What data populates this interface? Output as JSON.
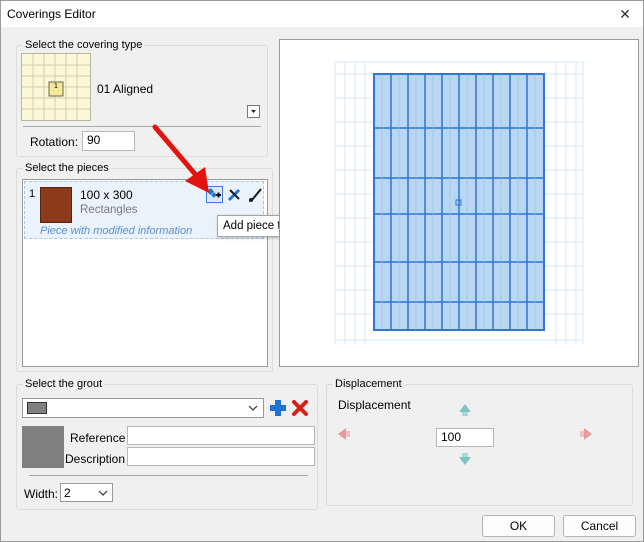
{
  "window": {
    "title": "Coverings Editor",
    "close_glyph": "✕"
  },
  "covering": {
    "section_label": "Select the covering type",
    "thumb_label": "1",
    "type_name": "01 Aligned",
    "rotation_label": "Rotation:",
    "rotation_value": "90"
  },
  "pieces": {
    "section_label": "Select the pieces",
    "items": [
      {
        "index": "1",
        "size": "100 x 300",
        "shape": "Rectangles",
        "note": "Piece with modified information"
      }
    ],
    "tooltip": "Add piece to library"
  },
  "grout": {
    "section_label": "Select the grout",
    "reference_label": "Reference",
    "reference_value": "",
    "description_label": "Description",
    "description_value": "",
    "width_label": "Width:",
    "width_value": "2"
  },
  "displacement": {
    "section_label": "Displacement",
    "inner_label": "Displacement",
    "value": "100"
  },
  "footer": {
    "ok_label": "OK",
    "cancel_label": "Cancel"
  },
  "colors": {
    "accent": "#1e73d8",
    "annotation": "#e3140f",
    "piece": "#8b3a1b"
  }
}
